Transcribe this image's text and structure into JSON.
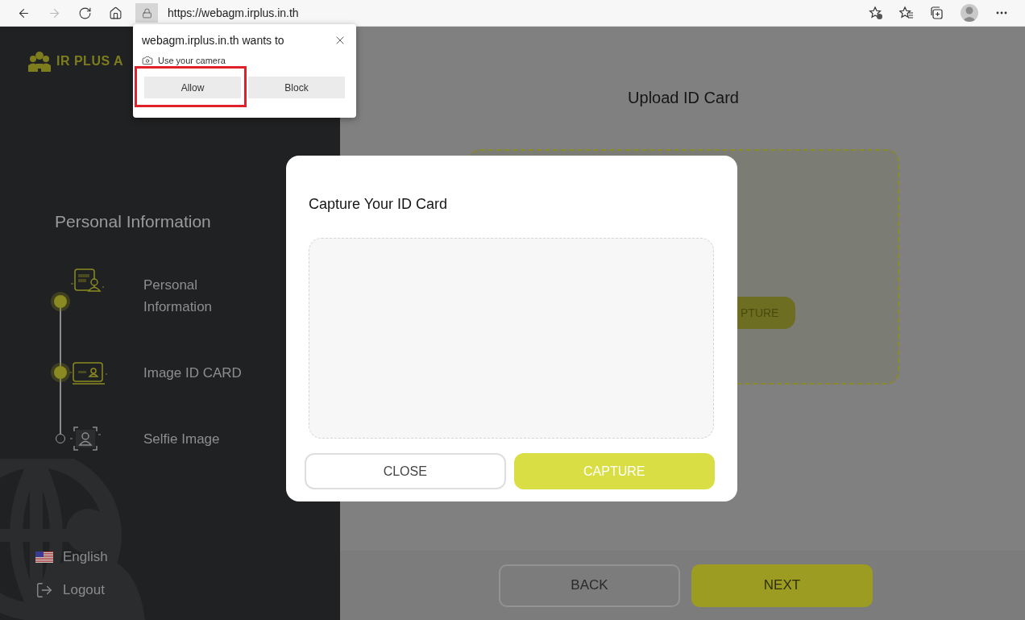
{
  "browser": {
    "url": "https://webagm.irplus.in.th",
    "forward_disabled": true
  },
  "permission_popup": {
    "title": "webagm.irplus.in.th wants to",
    "request": "Use your camera",
    "buttons": [
      {
        "label": "Allow",
        "highlighted": true
      },
      {
        "label": "Block",
        "highlighted": false
      }
    ]
  },
  "sidebar": {
    "logo": "IR PLUS A",
    "heading": "Personal Information",
    "steps": [
      {
        "label": "Personal Information",
        "done": true
      },
      {
        "label": "Image ID CARD",
        "done": true
      },
      {
        "label": "Selfie Image",
        "done": false
      }
    ],
    "language": "English",
    "logout": "Logout"
  },
  "main": {
    "title": "Upload ID Card",
    "capture_button": "PTURE",
    "buttons": [
      {
        "label": "BACK",
        "kind": "outline"
      },
      {
        "label": "NEXT",
        "kind": "filled"
      }
    ]
  },
  "modal": {
    "title": "Capture Your ID Card",
    "buttons": [
      {
        "label": "CLOSE",
        "kind": "outline"
      },
      {
        "label": "CAPTURE",
        "kind": "filled"
      }
    ]
  }
}
